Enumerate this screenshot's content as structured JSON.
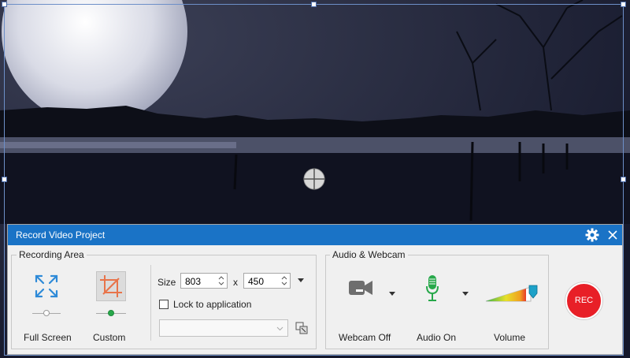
{
  "panel": {
    "title": "Record Video Project"
  },
  "recording_area": {
    "legend": "Recording Area",
    "full_screen_label": "Full Screen",
    "custom_label": "Custom",
    "size_label": "Size",
    "width_value": "803",
    "height_value": "450",
    "x_label": "x",
    "lock_label": "Lock to application",
    "application_value": ""
  },
  "audio_webcam": {
    "legend": "Audio & Webcam",
    "webcam_label": "Webcam Off",
    "audio_label": "Audio On",
    "volume_label": "Volume"
  },
  "rec_label": "REC",
  "colors": {
    "titlebar": "#1a73c6",
    "rec_button": "#e81f27",
    "fullscreen_icon": "#2e8ad8",
    "custom_icon": "#e8744a",
    "mic": "#27a84a"
  }
}
